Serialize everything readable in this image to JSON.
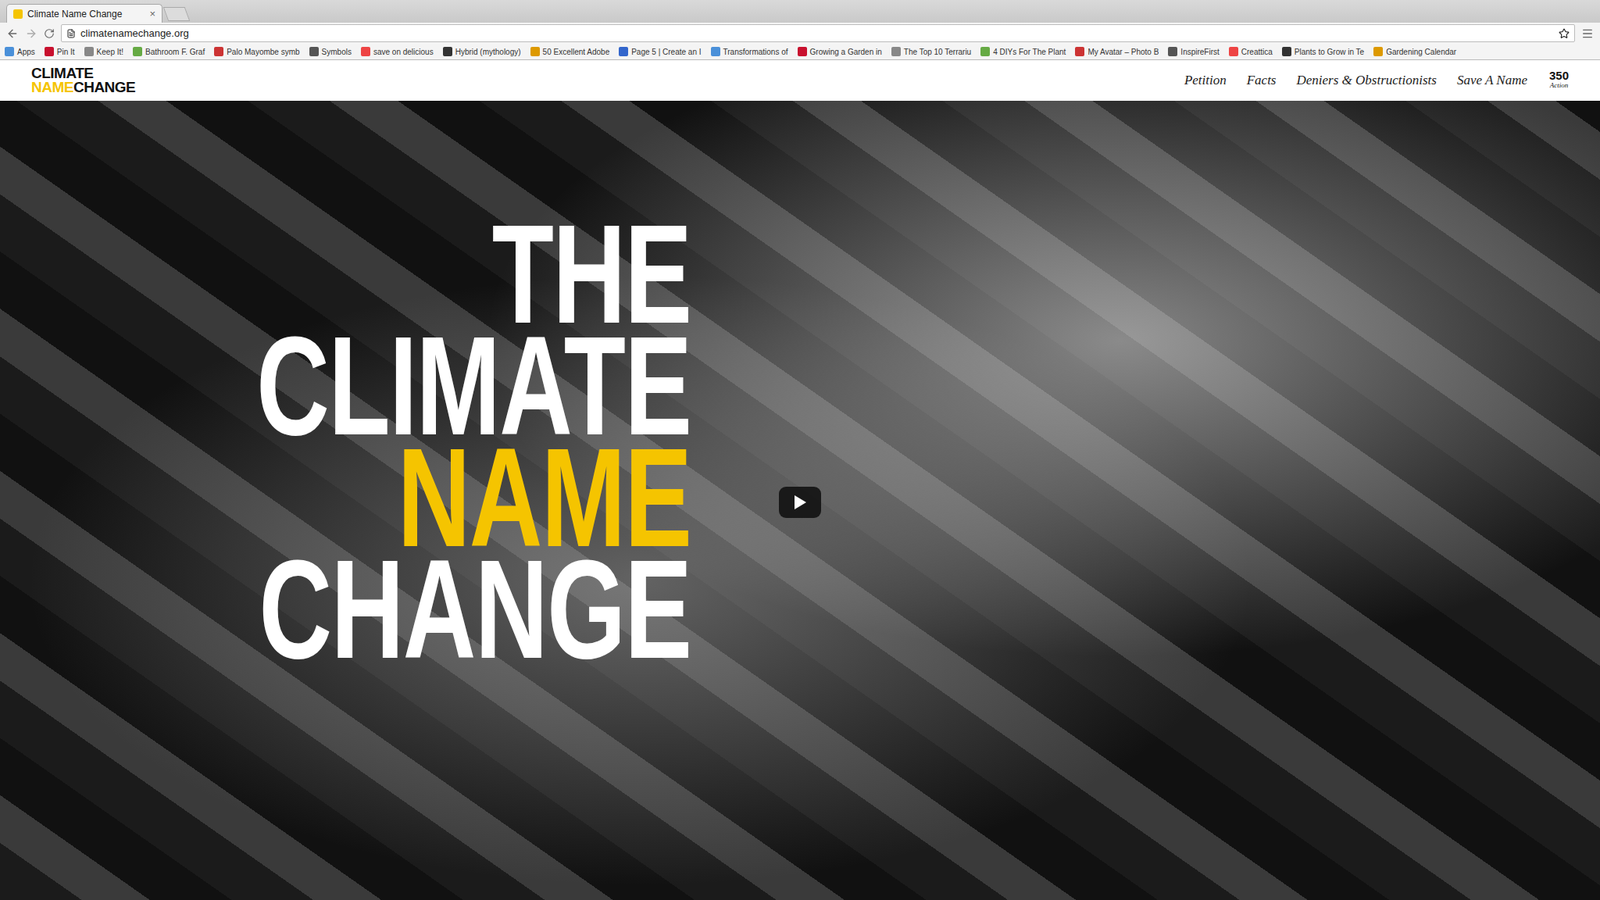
{
  "browser": {
    "tab": {
      "title": "Climate Name Change",
      "close": "×",
      "selected": true
    },
    "url": "climatenamechange.org"
  },
  "bookmarks": [
    {
      "label": "Apps"
    },
    {
      "label": "Pin It"
    },
    {
      "label": "Keep It!"
    },
    {
      "label": "Bathroom F. Graf"
    },
    {
      "label": "Palo Mayombe symb"
    },
    {
      "label": "Symbols"
    },
    {
      "label": "save on delicious"
    },
    {
      "label": "Hybrid (mythology)"
    },
    {
      "label": "50 Excellent Adobe"
    },
    {
      "label": "Page 5 | Create an I"
    },
    {
      "label": "Transformations of"
    },
    {
      "label": "Growing a Garden in"
    },
    {
      "label": "The Top 10 Terrariu"
    },
    {
      "label": "4 DIYs For The Plant"
    },
    {
      "label": "My Avatar – Photo B"
    },
    {
      "label": "InspireFirst"
    },
    {
      "label": "Creattica"
    },
    {
      "label": "Plants to Grow in Te"
    },
    {
      "label": "Gardening Calendar"
    }
  ],
  "site": {
    "logo": {
      "top": "CLIMATE",
      "highlight": "NAME",
      "rest": "CHANGE"
    },
    "nav": [
      {
        "label": "Petition",
        "selected": false
      },
      {
        "label": "Facts",
        "selected": false
      },
      {
        "label": "Deniers & Obstructionists",
        "selected": false
      },
      {
        "label": "Save A Name",
        "selected": false
      }
    ],
    "partner": {
      "number": "350",
      "label": "Action"
    }
  },
  "hero": {
    "lines": [
      {
        "text": "THE",
        "color": "#ffffff"
      },
      {
        "text": "CLIMATE",
        "color": "#ffffff"
      },
      {
        "text": "NAME",
        "color": "#f5c400"
      },
      {
        "text": "CHANGE",
        "color": "#ffffff"
      }
    ],
    "video": {
      "playing": false
    }
  }
}
